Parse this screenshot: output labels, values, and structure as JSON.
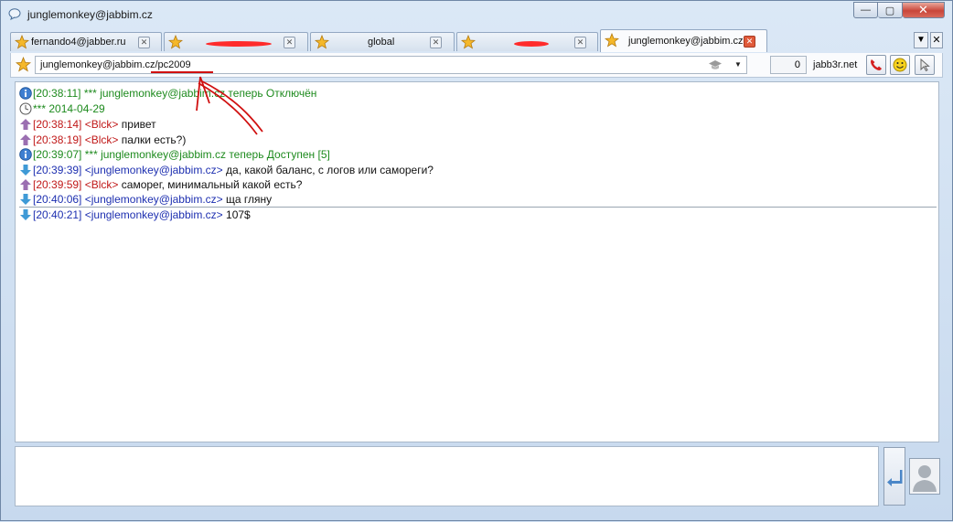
{
  "window": {
    "title": "junglemonkey@jabbim.cz",
    "buttons": {
      "minimize": "—",
      "maximize": "▢",
      "close": "✕"
    }
  },
  "tabs": [
    {
      "label": "fernando4@jabber.ru",
      "active": false,
      "close": "✕"
    },
    {
      "label": "",
      "active": false,
      "close": "✕"
    },
    {
      "label": "global",
      "active": false,
      "close": "✕"
    },
    {
      "label": "",
      "active": false,
      "close": "✕"
    },
    {
      "label": "junglemonkey@jabbim.cz",
      "active": true,
      "close": "✕"
    }
  ],
  "tab_menu": {
    "arrow": "▼",
    "close": "✕"
  },
  "toolbar": {
    "jid": "junglemonkey@jabbim.cz/pc2009",
    "combo_arrow": "▼",
    "unread_count": "0",
    "server": "jabb3r.net"
  },
  "messages": [
    {
      "kind": "info",
      "time": "[20:38:11]",
      "sender": "",
      "text": "*** junglemonkey@jabbim.cz теперь Отключён"
    },
    {
      "kind": "date",
      "time": "",
      "sender": "",
      "text": "*** 2014-04-29"
    },
    {
      "kind": "out",
      "time": "[20:38:14]",
      "sender": "<Blck>",
      "text": "привет"
    },
    {
      "kind": "out",
      "time": "[20:38:19]",
      "sender": "<Blck>",
      "text": "палки есть?)"
    },
    {
      "kind": "info",
      "time": "[20:39:07]",
      "sender": "",
      "text": "*** junglemonkey@jabbim.cz теперь Доступен [5]"
    },
    {
      "kind": "in",
      "time": "[20:39:39]",
      "sender": "<junglemonkey@jabbim.cz>",
      "text": "да, какой баланс, с логов или самореги?"
    },
    {
      "kind": "out",
      "time": "[20:39:59]",
      "sender": "<Blck>",
      "text": "саморег, минимальный какой есть?"
    },
    {
      "kind": "in",
      "time": "[20:40:06]",
      "sender": "<junglemonkey@jabbim.cz>",
      "text": "ща гляну"
    },
    {
      "kind": "in",
      "time": "[20:40:21]",
      "sender": "<junglemonkey@jabbim.cz>",
      "text": "107$"
    }
  ],
  "colors": {
    "system": "#1d8a1d",
    "outgoing": "#c01818",
    "incoming": "#1d2fb0",
    "annotation": "#d01010"
  }
}
